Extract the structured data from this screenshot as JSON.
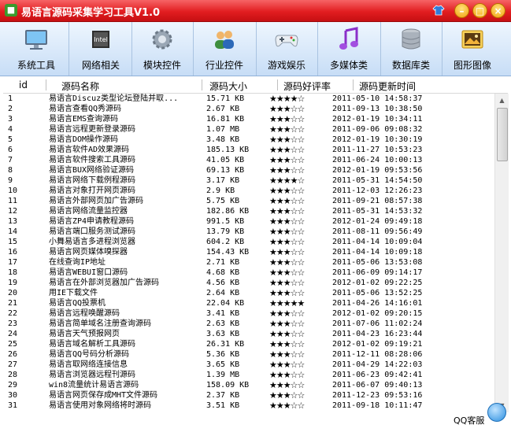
{
  "window": {
    "title": "易语言源码采集学习工具V1.0"
  },
  "toolbar": {
    "items": [
      {
        "label": "系统工具",
        "icon": "monitor-icon"
      },
      {
        "label": "网络相关",
        "icon": "chip-icon"
      },
      {
        "label": "模块控件",
        "icon": "gear-icon"
      },
      {
        "label": "行业控件",
        "icon": "users-icon"
      },
      {
        "label": "游戏娱乐",
        "icon": "gamepad-icon"
      },
      {
        "label": "多媒体类",
        "icon": "music-note-icon"
      },
      {
        "label": "数据库类",
        "icon": "database-icon"
      },
      {
        "label": "图形图像",
        "icon": "picture-icon"
      }
    ]
  },
  "table": {
    "columns": [
      "id",
      "源码名称",
      "源码大小",
      "源码好评率",
      "源码更新时间"
    ],
    "rows": [
      {
        "id": "1",
        "name": "易语言Discuz类型论坛登陆并取...",
        "size": "15.71 KB",
        "stars": "★★★★☆",
        "date": "2011-05-10 14:58:37"
      },
      {
        "id": "2",
        "name": "易语言查看QQ秀源码",
        "size": "2.67 KB",
        "stars": "★★★☆☆",
        "date": "2011-09-13 10:38:50"
      },
      {
        "id": "3",
        "name": "易语言EMS查询源码",
        "size": "16.81 KB",
        "stars": "★★★☆☆",
        "date": "2012-01-19 10:34:11"
      },
      {
        "id": "4",
        "name": "易语言远程更新登录源码",
        "size": "1.07 MB",
        "stars": "★★★☆☆",
        "date": "2011-09-06 09:08:32"
      },
      {
        "id": "5",
        "name": "易语言DOM操作源码",
        "size": "3.48 KB",
        "stars": "★★★☆☆",
        "date": "2012-01-19 10:30:19"
      },
      {
        "id": "6",
        "name": "易语言软件AD效果源码",
        "size": "185.13 KB",
        "stars": "★★★☆☆",
        "date": "2011-11-27 10:53:23"
      },
      {
        "id": "7",
        "name": "易语言软件搜索工具源码",
        "size": "41.05 KB",
        "stars": "★★★☆☆",
        "date": "2011-06-24 10:00:13"
      },
      {
        "id": "8",
        "name": "易语言BUX网络验证源码",
        "size": "69.13 KB",
        "stars": "★★★☆☆",
        "date": "2012-01-19 09:53:56"
      },
      {
        "id": "9",
        "name": "易语言网络下载例程源码",
        "size": "3.17 KB",
        "stars": "★★★★☆",
        "date": "2011-05-31 14:54:50"
      },
      {
        "id": "10",
        "name": "易语言对象打开网页源码",
        "size": "2.9 KB",
        "stars": "★★★☆☆",
        "date": "2011-12-03 12:26:23"
      },
      {
        "id": "11",
        "name": "易语言外部网页加广告源码",
        "size": "5.75 KB",
        "stars": "★★★☆☆",
        "date": "2011-09-21 08:57:38"
      },
      {
        "id": "12",
        "name": "易语言网络流量监控器",
        "size": "182.86 KB",
        "stars": "★★★☆☆",
        "date": "2011-05-31 14:53:32"
      },
      {
        "id": "13",
        "name": "易语言ZP4申请教程源码",
        "size": "991.5 KB",
        "stars": "★★★☆☆",
        "date": "2012-01-24 09:49:18"
      },
      {
        "id": "14",
        "name": "易语言端口服务测试源码",
        "size": "13.79 KB",
        "stars": "★★★☆☆",
        "date": "2011-08-11 09:56:49"
      },
      {
        "id": "15",
        "name": "小舞易语言多进程浏览器",
        "size": "604.2 KB",
        "stars": "★★★☆☆",
        "date": "2011-04-14 10:09:04"
      },
      {
        "id": "16",
        "name": "易语言网页媒体嗅探器",
        "size": "154.43 KB",
        "stars": "★★★☆☆",
        "date": "2011-04-14 10:09:18"
      },
      {
        "id": "17",
        "name": "在线查询IP地址",
        "size": "2.71 KB",
        "stars": "★★★☆☆",
        "date": "2011-05-06 13:53:08"
      },
      {
        "id": "18",
        "name": "易语言WEBUI窗口源码",
        "size": "4.68 KB",
        "stars": "★★★☆☆",
        "date": "2011-06-09 09:14:17"
      },
      {
        "id": "19",
        "name": "易语言在外部浏览器加广告源码",
        "size": "4.56 KB",
        "stars": "★★★☆☆",
        "date": "2012-01-02 09:22:25"
      },
      {
        "id": "20",
        "name": "用IE下载文件",
        "size": "2.64 KB",
        "stars": "★★★☆☆",
        "date": "2011-05-06 13:52:25"
      },
      {
        "id": "21",
        "name": "易语言QQ投票机",
        "size": "22.04 KB",
        "stars": "★★★★★",
        "date": "2011-04-26 14:16:01"
      },
      {
        "id": "22",
        "name": "易语言远程唤醒源码",
        "size": "3.41 KB",
        "stars": "★★★☆☆",
        "date": "2012-01-02 09:20:15"
      },
      {
        "id": "23",
        "name": "易语言简单域名注册查询源码",
        "size": "2.63 KB",
        "stars": "★★★☆☆",
        "date": "2011-07-06 11:02:24"
      },
      {
        "id": "24",
        "name": "易语言天气预报网页",
        "size": "3.63 KB",
        "stars": "★★★☆☆",
        "date": "2011-04-23 16:23:44"
      },
      {
        "id": "25",
        "name": "易语言域名解析工具源码",
        "size": "26.31 KB",
        "stars": "★★★☆☆",
        "date": "2012-01-02 09:19:21"
      },
      {
        "id": "26",
        "name": "易语言QQ号码分析源码",
        "size": "5.36 KB",
        "stars": "★★★☆☆",
        "date": "2011-12-11 08:28:06"
      },
      {
        "id": "27",
        "name": "易语言取网络连接信息",
        "size": "3.65 KB",
        "stars": "★★★☆☆",
        "date": "2011-04-29 14:22:03"
      },
      {
        "id": "28",
        "name": "易语言浏览器远程刊源码",
        "size": "1.39 MB",
        "stars": "★★★☆☆",
        "date": "2011-06-23 09:42:41"
      },
      {
        "id": "29",
        "name": "win8流量统计易语言源码",
        "size": "158.09 KB",
        "stars": "★★★☆☆",
        "date": "2011-06-07 09:40:13"
      },
      {
        "id": "30",
        "name": "易语言网页保存成MHT文件源码",
        "size": "2.37 KB",
        "stars": "★★★☆☆",
        "date": "2011-12-23 09:53:16"
      },
      {
        "id": "31",
        "name": "易语言使用对象网络将时源码",
        "size": "3.51 KB",
        "stars": "★★★☆☆",
        "date": "2011-09-18 10:11:47"
      }
    ]
  },
  "status": {
    "qq_service_label": "QQ客服"
  },
  "colors": {
    "titlebar": "#e21d20",
    "toolbar": "#c7ddf6",
    "accent": "#f2a10c"
  }
}
